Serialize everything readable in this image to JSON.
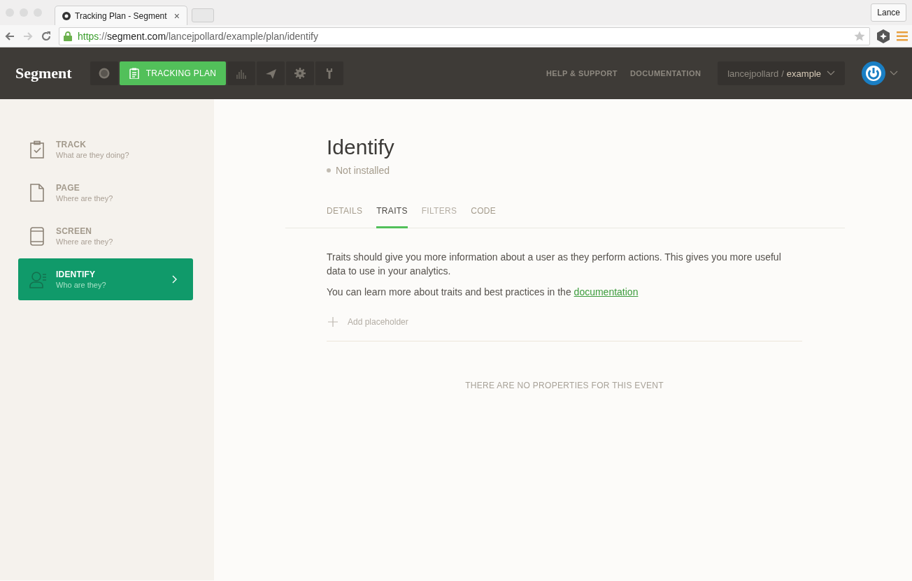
{
  "browser": {
    "tab_title": "Tracking Plan - Segment",
    "tab_close": "×",
    "profile": "Lance",
    "url": [
      {
        "kind": "scheme",
        "text": "https"
      },
      {
        "kind": "sep",
        "text": "://"
      },
      {
        "kind": "host",
        "text": "segment.com"
      },
      {
        "kind": "path",
        "text": "/lancejpollard/example/plan/identify"
      }
    ]
  },
  "header": {
    "logo": "Segment",
    "nav": [
      {
        "kind": "sources",
        "selected": false
      },
      {
        "kind": "plan",
        "label": "TRACKING PLAN",
        "selected": true
      },
      {
        "kind": "bars",
        "selected": false
      },
      {
        "kind": "plane",
        "selected": false
      },
      {
        "kind": "gear",
        "selected": false
      },
      {
        "kind": "wrench",
        "selected": false
      }
    ],
    "links": [
      "HELP & SUPPORT",
      "DOCUMENTATION"
    ],
    "workspace": {
      "owner": "lancejpollard",
      "separator": "/",
      "project": "example"
    }
  },
  "sidebar": {
    "items": [
      {
        "kind": "track",
        "label": "TRACK",
        "subtitle": "What are they doing?",
        "selected": false
      },
      {
        "kind": "page",
        "label": "PAGE",
        "subtitle": "Where are they?",
        "selected": false
      },
      {
        "kind": "screen",
        "label": "SCREEN",
        "subtitle": "Where are they?",
        "selected": false
      },
      {
        "kind": "identify",
        "label": "IDENTIFY",
        "subtitle": "Who are they?",
        "selected": true
      }
    ]
  },
  "content": {
    "title": "Identify",
    "status": "Not installed",
    "tabs": [
      {
        "label": "DETAILS",
        "selected": false,
        "disabled": false
      },
      {
        "label": "TRAITS",
        "selected": true,
        "disabled": false
      },
      {
        "label": "FILTERS",
        "selected": false,
        "disabled": true
      },
      {
        "label": "CODE",
        "selected": false,
        "disabled": false
      }
    ],
    "description": "Traits should give you more information about a user as they perform actions. This gives you more useful data to use in your analytics.",
    "learn_more": {
      "text": "You can learn more about traits and best practices in the ",
      "link": "documentation"
    },
    "add_placeholder": "Add placeholder",
    "empty_message": "THERE ARE NO PROPERTIES FOR THIS EVENT"
  }
}
